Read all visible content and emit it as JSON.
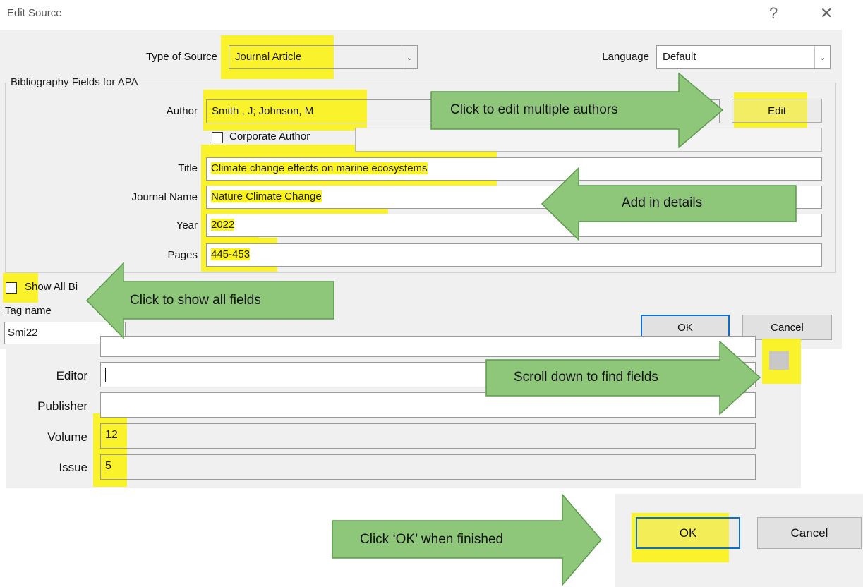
{
  "dialog": {
    "title": "Edit Source",
    "help_glyph": "?",
    "close_glyph": "✕",
    "type_of_source_label_pre": "Type of ",
    "type_of_source_label_key": "S",
    "type_of_source_label_post": "ource",
    "type_of_source_value": "Journal Article",
    "language_label_key": "L",
    "language_label_post": "anguage",
    "language_value": "Default",
    "fieldset_legend": "Bibliography Fields for APA",
    "fields": {
      "author_label": "Author",
      "author_value": "Smith , J; Johnson, M",
      "edit_button": "Edit",
      "corporate_author_label": "Corporate Author",
      "title_label": "Title",
      "title_value": "Climate change effects on marine ecosystems",
      "journal_label": "Journal Name",
      "journal_value": "Nature Climate Change",
      "year_label": "Year",
      "year_value": "2022",
      "pages_label": "Pages",
      "pages_value": "445-453"
    },
    "show_all_pre": "Show ",
    "show_all_key": "A",
    "show_all_post": "ll Bi",
    "tag_name_key": "T",
    "tag_name_post": "ag name",
    "tag_value": "Smi22",
    "ok_button": "OK",
    "cancel_button": "Cancel"
  },
  "more_fields": {
    "editor_label": "Editor",
    "editor_value": "",
    "publisher_label": "Publisher",
    "publisher_value": "",
    "volume_label": "Volume",
    "volume_value": "12",
    "issue_label": "Issue",
    "issue_value": "5"
  },
  "final_buttons": {
    "ok_button": "OK",
    "cancel_button": "Cancel"
  },
  "callouts": {
    "edit_authors": "Click to edit multiple authors",
    "add_details": "Add in details",
    "show_all": "Click to show all fields",
    "scroll_down": "Scroll down to find fields",
    "click_ok": "Click ‘OK’ when finished"
  },
  "colors": {
    "highlight": "#fbf31a",
    "callout_fill": "#8fc77a",
    "callout_stroke": "#5b9a4c",
    "default_button_border": "#0a6ed1"
  }
}
